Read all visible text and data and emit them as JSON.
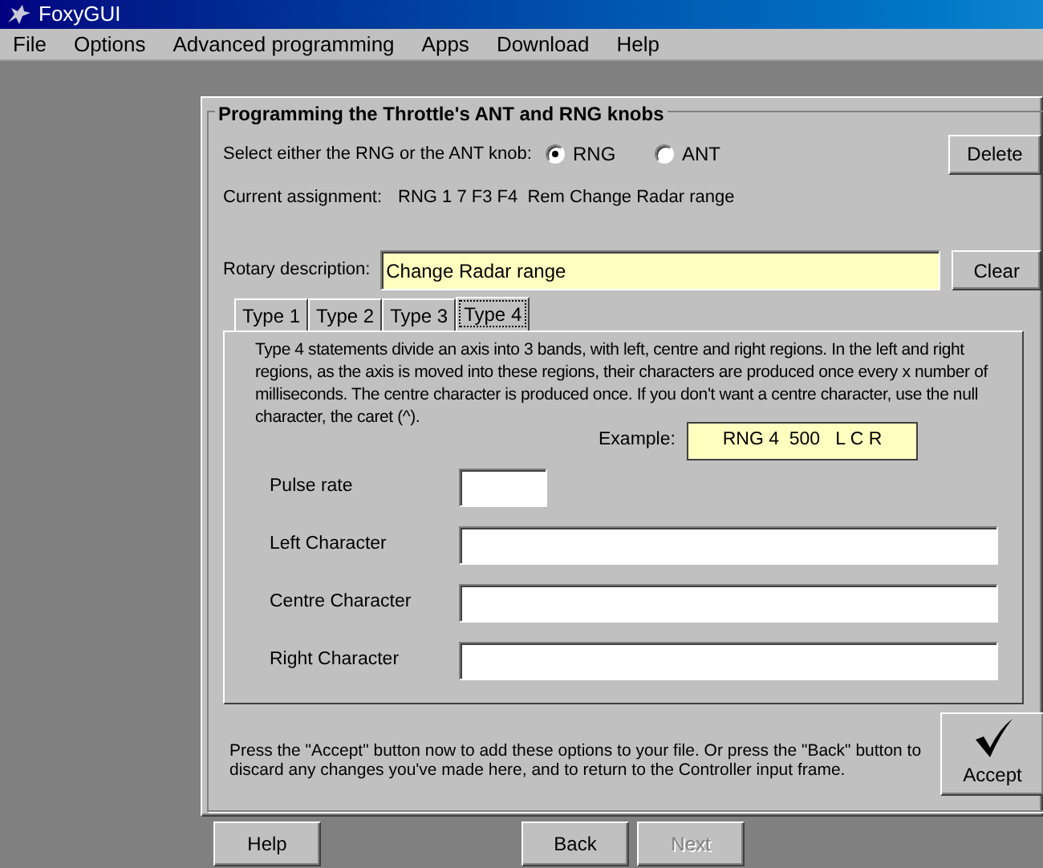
{
  "window": {
    "title": "FoxyGUI"
  },
  "menu": [
    "File",
    "Options",
    "Advanced programming",
    "Apps",
    "Download",
    "Help"
  ],
  "group": {
    "title": "Programming the Throttle's ANT and RNG knobs"
  },
  "knob_select": {
    "label": "Select either the RNG or the ANT knob:",
    "options": [
      {
        "label": "RNG",
        "selected": true
      },
      {
        "label": "ANT",
        "selected": false
      }
    ]
  },
  "delete_button": "Delete",
  "current_assignment": {
    "label": "Current assignment:",
    "value": "RNG 1 7 F3 F4  Rem Change Radar range"
  },
  "rotary": {
    "label": "Rotary description:",
    "value": "Change Radar range"
  },
  "clear_button": "Clear",
  "tabs": [
    {
      "label": "Type 1",
      "selected": false
    },
    {
      "label": "Type 2",
      "selected": false
    },
    {
      "label": "Type 3",
      "selected": false
    },
    {
      "label": "Type 4",
      "selected": true
    }
  ],
  "description": "Type 4 statements divide an axis into 3 bands, with left, centre and right regions. In the left and right regions, as the axis is moved into these regions, their characters are produced once every x number of milliseconds. The centre character is produced once. If you don't want a centre character, use the null character, the caret (^).",
  "example": {
    "label": "Example:",
    "value": "RNG 4  500   L C R"
  },
  "fields": [
    {
      "label": "Pulse rate",
      "kind": "short"
    },
    {
      "label": "Left Character",
      "kind": "long"
    },
    {
      "label": "Centre Character",
      "kind": "long"
    },
    {
      "label": "Right Character",
      "kind": "long"
    }
  ],
  "footer_text": "Press the \"Accept\" button now to add these options to your file.  Or press the \"Back\" button to discard any changes you've made here, and to return to the Controller input frame.",
  "accept_button": "Accept",
  "nav_buttons": [
    {
      "label": "Help",
      "disabled": false
    },
    {
      "label": "Back",
      "disabled": false
    },
    {
      "label": "Next",
      "disabled": true
    }
  ]
}
